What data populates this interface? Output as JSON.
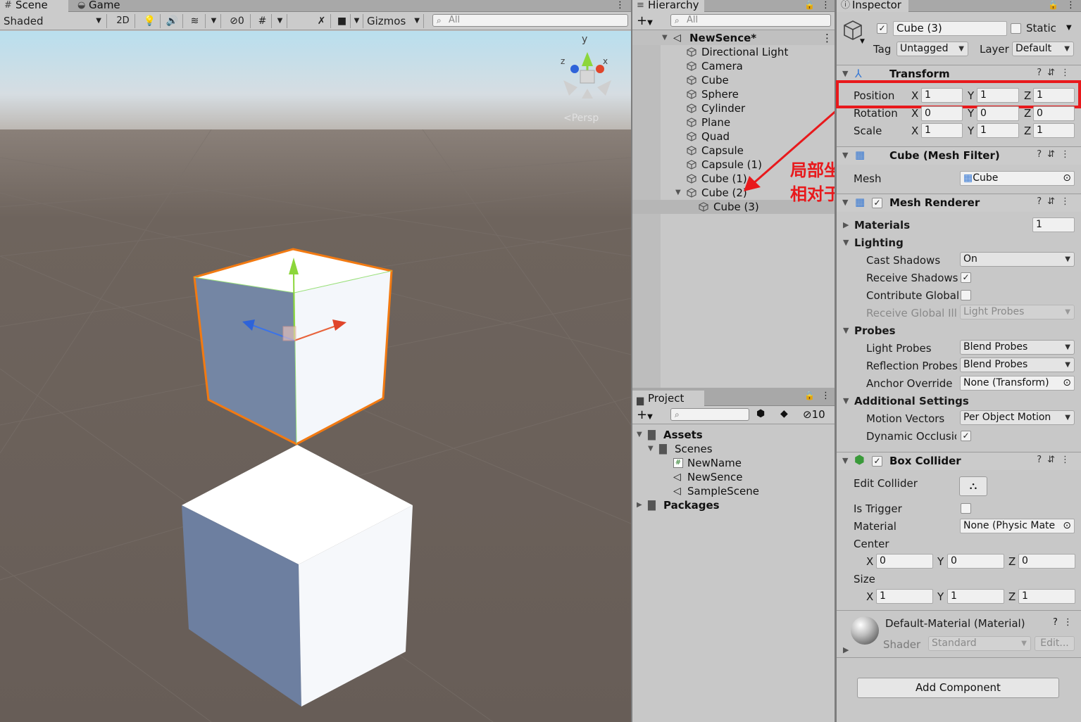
{
  "scene_tabs": {
    "scene": "Scene",
    "game": "Game"
  },
  "scene_toolbar": {
    "shading": "Shaded",
    "mode_2d": "2D",
    "hidden_count": "0",
    "gizmos": "Gizmos",
    "search_placeholder": "All"
  },
  "gizmo": {
    "y": "y",
    "x": "x",
    "z": "z",
    "persp": "Persp"
  },
  "hierarchy": {
    "tab": "Hierarchy",
    "search_placeholder": "All",
    "scene_name": "NewSence*",
    "items": [
      "Directional Light",
      "Camera",
      "Cube",
      "Sphere",
      "Cylinder",
      "Plane",
      "Quad",
      "Capsule",
      "Capsule (1)",
      "Cube (1)",
      "Cube (2)"
    ],
    "child": "Cube (3)"
  },
  "annotation": {
    "line1": "局部坐标系，",
    "line2": "相对于父物体",
    "color": "#e8191c"
  },
  "project": {
    "tab": "Project",
    "hidden_count": "10",
    "assets": "Assets",
    "scenes": "Scenes",
    "files": [
      "NewName",
      "NewSence",
      "SampleScene"
    ],
    "packages": "Packages"
  },
  "inspector": {
    "tab": "Inspector",
    "object_name": "Cube (3)",
    "static_label": "Static",
    "tag_label": "Tag",
    "tag_value": "Untagged",
    "layer_label": "Layer",
    "layer_value": "Default",
    "transform": {
      "title": "Transform",
      "position_label": "Position",
      "position": {
        "x": "1",
        "y": "1",
        "z": "1"
      },
      "rotation_label": "Rotation",
      "rotation": {
        "x": "0",
        "y": "0",
        "z": "0"
      },
      "scale_label": "Scale",
      "scale": {
        "x": "1",
        "y": "1",
        "z": "1"
      },
      "axis_x": "X",
      "axis_y": "Y",
      "axis_z": "Z"
    },
    "mesh_filter": {
      "title": "Cube (Mesh Filter)",
      "mesh_label": "Mesh",
      "mesh_value": "Cube"
    },
    "mesh_renderer": {
      "title": "Mesh Renderer",
      "materials_label": "Materials",
      "materials_count": "1",
      "lighting_label": "Lighting",
      "cast_shadows_label": "Cast Shadows",
      "cast_shadows_value": "On",
      "receive_shadows_label": "Receive Shadows",
      "contribute_global_label": "Contribute Global",
      "receive_global_label": "Receive Global Illu",
      "receive_global_value": "Light Probes",
      "probes_label": "Probes",
      "light_probes_label": "Light Probes",
      "light_probes_value": "Blend Probes",
      "reflection_probes_label": "Reflection Probes",
      "reflection_probes_value": "Blend Probes",
      "anchor_override_label": "Anchor Override",
      "anchor_override_value": "None (Transform)",
      "additional_label": "Additional Settings",
      "motion_vectors_label": "Motion Vectors",
      "motion_vectors_value": "Per Object Motion",
      "dynamic_occlusion_label": "Dynamic Occlusic"
    },
    "box_collider": {
      "title": "Box Collider",
      "edit_collider_label": "Edit Collider",
      "is_trigger_label": "Is Trigger",
      "material_label": "Material",
      "material_value": "None (Physic Mate",
      "center_label": "Center",
      "center": {
        "x": "0",
        "y": "0",
        "z": "0"
      },
      "size_label": "Size",
      "size": {
        "x": "1",
        "y": "1",
        "z": "1"
      }
    },
    "material": {
      "title": "Default-Material (Material)",
      "shader_label": "Shader",
      "shader_value": "Standard",
      "edit_label": "Edit..."
    },
    "add_component": "Add Component"
  }
}
